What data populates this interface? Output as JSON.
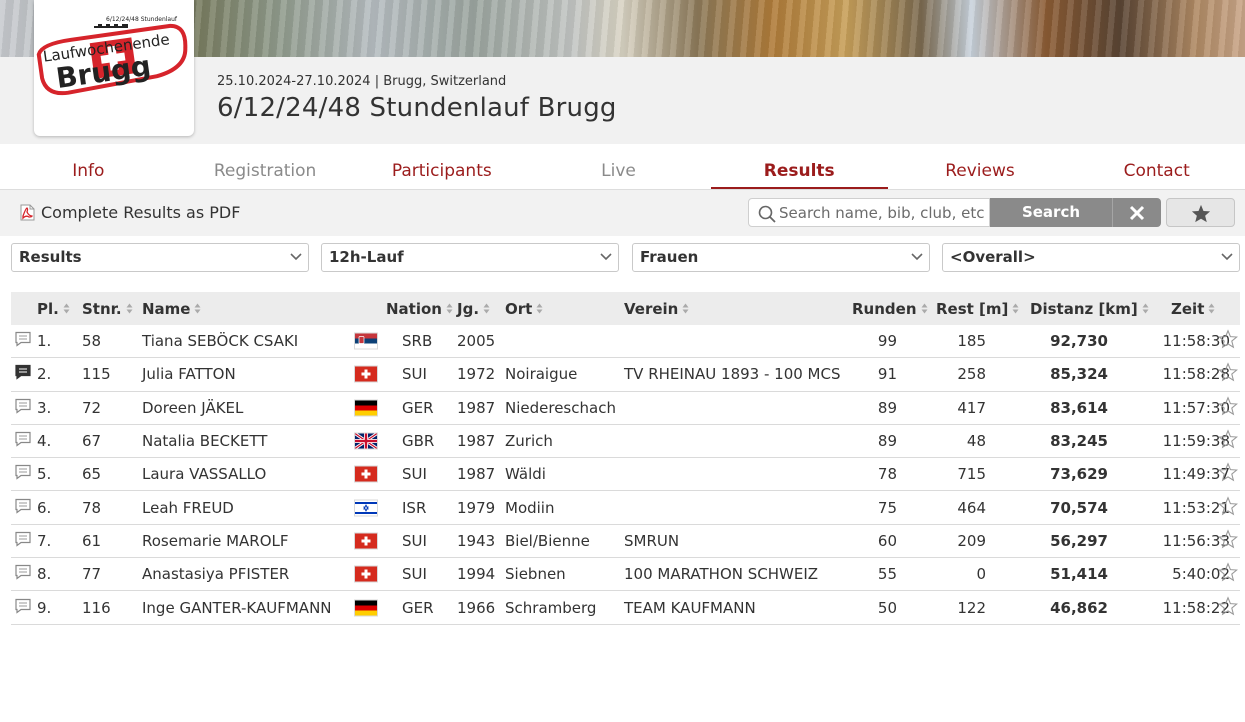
{
  "event": {
    "logo_text": "Laufwochenende Brugg",
    "logo_small": "6/12/24/48 Stundenlauf",
    "date_location": "25.10.2024-27.10.2024 | Brugg, Switzerland",
    "title": "6/12/24/48 Stundenlauf Brugg"
  },
  "tabs": [
    {
      "label": "Info",
      "state": "normal"
    },
    {
      "label": "Registration",
      "state": "disabled"
    },
    {
      "label": "Participants",
      "state": "normal"
    },
    {
      "label": "Live",
      "state": "disabled"
    },
    {
      "label": "Results",
      "state": "active"
    },
    {
      "label": "Reviews",
      "state": "normal"
    },
    {
      "label": "Contact",
      "state": "normal"
    }
  ],
  "toolbar": {
    "pdf_label": "Complete Results as PDF",
    "search_placeholder": "Search name, bib, club, etc.",
    "search_value": "",
    "search_button": "Search"
  },
  "filters": {
    "list": "Results",
    "contest": "12h-Lauf",
    "category": "Frauen",
    "group": "<Overall>"
  },
  "columns": {
    "place": "Pl.",
    "bib": "Stnr.",
    "name": "Name",
    "nation": "Nation",
    "year": "Jg.",
    "city": "Ort",
    "club": "Verein",
    "laps": "Runden",
    "rest": "Rest [m]",
    "distance": "Distanz [km]",
    "time": "Zeit"
  },
  "rows": [
    {
      "place": "1.",
      "bib": "58",
      "name": "Tiana SEBÖCK CSAKI",
      "flag": "srb",
      "nation": "SRB",
      "year": "2005",
      "city": "",
      "club": "",
      "laps": "99",
      "rest": "185",
      "distance": "92,730",
      "time": "11:58:30",
      "comment": false
    },
    {
      "place": "2.",
      "bib": "115",
      "name": "Julia FATTON",
      "flag": "sui",
      "nation": "SUI",
      "year": "1972",
      "city": "Noiraigue",
      "club": "TV RHEINAU 1893 - 100 MCS",
      "laps": "91",
      "rest": "258",
      "distance": "85,324",
      "time": "11:58:28",
      "comment": true
    },
    {
      "place": "3.",
      "bib": "72",
      "name": "Doreen JÄKEL",
      "flag": "ger",
      "nation": "GER",
      "year": "1987",
      "city": "Niedereschach",
      "club": "",
      "laps": "89",
      "rest": "417",
      "distance": "83,614",
      "time": "11:57:30",
      "comment": false
    },
    {
      "place": "4.",
      "bib": "67",
      "name": "Natalia BECKETT",
      "flag": "gbr",
      "nation": "GBR",
      "year": "1987",
      "city": "Zurich",
      "club": "",
      "laps": "89",
      "rest": "48",
      "distance": "83,245",
      "time": "11:59:38",
      "comment": false
    },
    {
      "place": "5.",
      "bib": "65",
      "name": "Laura VASSALLO",
      "flag": "sui",
      "nation": "SUI",
      "year": "1987",
      "city": "Wäldi",
      "club": "",
      "laps": "78",
      "rest": "715",
      "distance": "73,629",
      "time": "11:49:37",
      "comment": false
    },
    {
      "place": "6.",
      "bib": "78",
      "name": "Leah FREUD",
      "flag": "isr",
      "nation": "ISR",
      "year": "1979",
      "city": "Modiin",
      "club": "",
      "laps": "75",
      "rest": "464",
      "distance": "70,574",
      "time": "11:53:21",
      "comment": false
    },
    {
      "place": "7.",
      "bib": "61",
      "name": "Rosemarie MAROLF",
      "flag": "sui",
      "nation": "SUI",
      "year": "1943",
      "city": "Biel/Bienne",
      "club": "SMRUN",
      "laps": "60",
      "rest": "209",
      "distance": "56,297",
      "time": "11:56:33",
      "comment": false
    },
    {
      "place": "8.",
      "bib": "77",
      "name": "Anastasiya PFISTER",
      "flag": "sui",
      "nation": "SUI",
      "year": "1994",
      "city": "Siebnen",
      "club": "100 MARATHON SCHWEIZ",
      "laps": "55",
      "rest": "0",
      "distance": "51,414",
      "time": "5:40:02",
      "comment": false
    },
    {
      "place": "9.",
      "bib": "116",
      "name": "Inge GANTER-KAUFMANN",
      "flag": "ger",
      "nation": "GER",
      "year": "1966",
      "city": "Schramberg",
      "club": "TEAM KAUFMANN",
      "laps": "50",
      "rest": "122",
      "distance": "46,862",
      "time": "11:58:22",
      "comment": false
    }
  ],
  "colors": {
    "accent": "#9b1c1c",
    "button_gray": "#8a8a8a",
    "header_band": "#f1f1f1"
  }
}
